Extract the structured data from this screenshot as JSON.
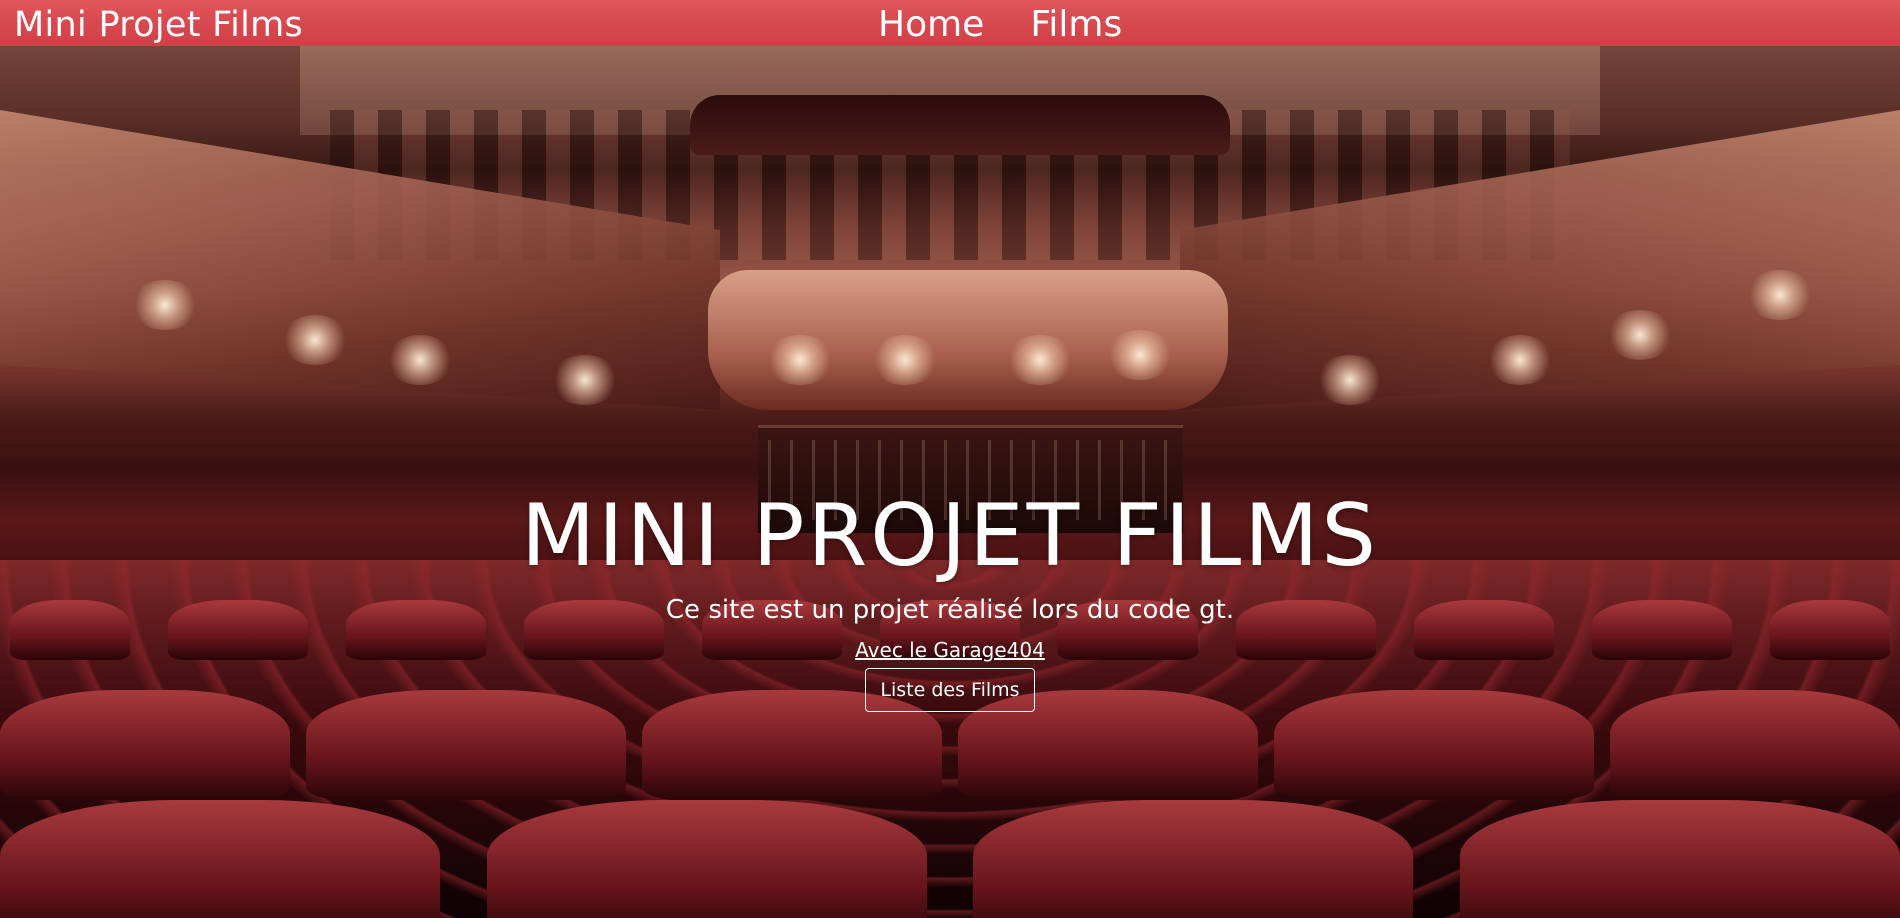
{
  "navbar": {
    "brand": "Mini Projet Films",
    "links": [
      {
        "label": "Home"
      },
      {
        "label": "Films"
      }
    ]
  },
  "hero": {
    "title": "MINI PROJET FILMS",
    "subtitle": "Ce site est un projet réalisé lors du code gt.",
    "link_text": "Avec le Garage404",
    "button_label": "Liste des Films",
    "background": "theater-auditorium-photo"
  },
  "colors": {
    "navbar": "#d9474e",
    "text": "#ffffff"
  }
}
